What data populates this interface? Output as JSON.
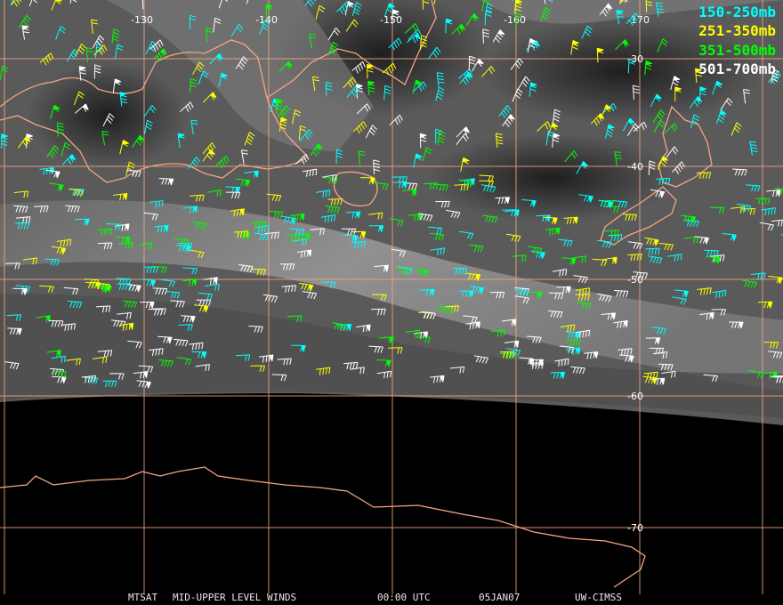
{
  "product": {
    "satellite": "MTSAT",
    "title": "MID-UPPER LEVEL WINDS",
    "time": "00:00 UTC",
    "date": "05JAN07",
    "credit": "UW-CIMSS"
  },
  "legend": [
    {
      "label": "150-250mb",
      "color": "#00ffff"
    },
    {
      "label": "251-350mb",
      "color": "#ffff00"
    },
    {
      "label": "351-500mb",
      "color": "#00ff00"
    },
    {
      "label": "501-700mb",
      "color": "#ffffff"
    }
  ],
  "grid": {
    "color": "#f4a582",
    "longitude_labels": [
      "-130",
      "-140",
      "-150",
      "-160",
      "-170"
    ],
    "latitude_labels": [
      "-30",
      "-40",
      "-50",
      "-60",
      "-70"
    ]
  }
}
